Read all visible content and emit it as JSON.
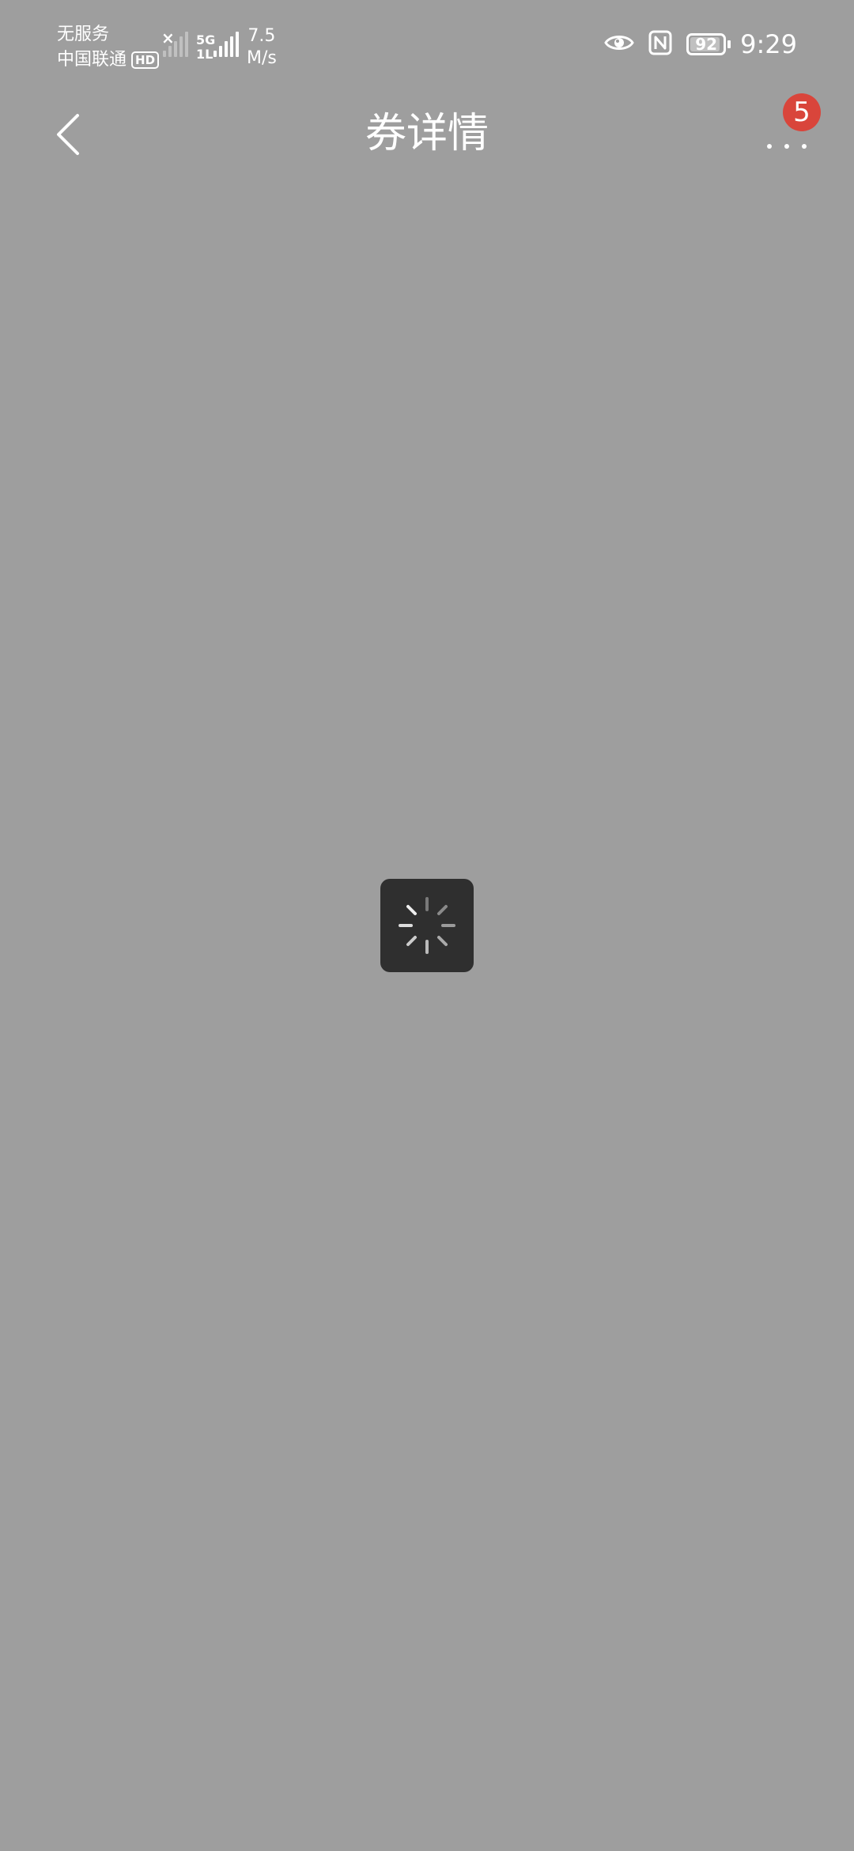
{
  "status_bar": {
    "carrier_1": "无服务",
    "carrier_2": "中国联通",
    "hd_label": "HD",
    "network_type": "5G",
    "network_sub": "1L",
    "speed_value": "7.5",
    "speed_unit": "M/s",
    "battery_level": "92",
    "battery_fraction": 0.92,
    "time": "9:29",
    "icons": [
      "no-signal-icon",
      "signal-icon",
      "eye-icon",
      "nfc-icon",
      "battery-icon"
    ]
  },
  "header": {
    "title": "券详情",
    "badge_count": "5",
    "back_icon": "chevron-left-icon",
    "more_icon": "more-dots-icon"
  },
  "loading": {
    "icon": "spinner-icon"
  },
  "colors": {
    "background": "#9e9e9e",
    "badge": "#d9453b",
    "loading_box": "#2f2f2f",
    "text": "#ffffff"
  }
}
